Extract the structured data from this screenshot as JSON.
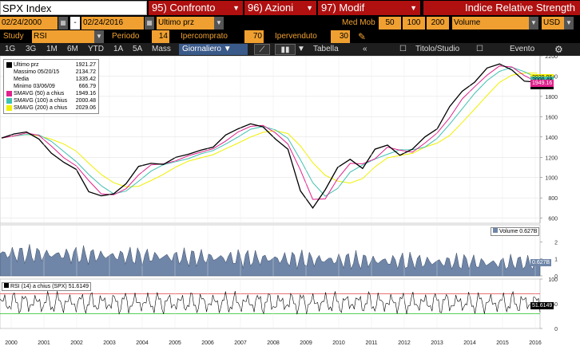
{
  "header": {
    "ticker": "SPX Index",
    "confronto": "95) Confronto",
    "azioni": "96) Azioni",
    "modif": "97) Modif",
    "title": "Indice Relative Strength"
  },
  "controls": {
    "date_from": "02/24/2000",
    "date_sep": "-",
    "date_to": "02/24/2016",
    "price_field": "Ultimo prz",
    "med_mob_label": "Med Mob",
    "ma1": "50",
    "ma2": "100",
    "ma3": "200",
    "volume_field": "Volume",
    "currency": "USD"
  },
  "study_row": {
    "study_label": "Study",
    "study_value": "RSI",
    "periodo_label": "Periodo",
    "periodo_value": "14",
    "ipercomprato_label": "Ipercomprato",
    "ipercomprato_value": "70",
    "ipervenduto_label": "Ipervenduto",
    "ipervenduto_value": "30"
  },
  "toolbar": {
    "ranges": [
      "1G",
      "3G",
      "1M",
      "6M",
      "YTD",
      "1A",
      "5A",
      "Mass"
    ],
    "period": "Giornaliero",
    "tabella": "Tabella",
    "titolo": "Titolo/Studio",
    "evento": "Evento"
  },
  "legend": {
    "items": [
      {
        "label": "Ultimo prz",
        "value": "1921.27",
        "color": "#000000"
      },
      {
        "label": "Massimo 05/20/15",
        "value": "2134.72",
        "color": ""
      },
      {
        "label": "Media",
        "value": "1335.42",
        "color": ""
      },
      {
        "label": "Minimo 03/06/09",
        "value": "666.79",
        "color": ""
      },
      {
        "label": "SMAVG (50) a chius",
        "value": "1949.16",
        "color": "#e0208c"
      },
      {
        "label": "SMAVG (100) a chius",
        "value": "2000.48",
        "color": "#40c0b0"
      },
      {
        "label": "SMAVG (200) a chius",
        "value": "2029.06",
        "color": "#f0f000"
      }
    ]
  },
  "volume_legend": "Volume 0.627B",
  "rsi_legend": "RSI (14) a chius (SPX) 51.6149",
  "price_tags": {
    "last": "1921.27",
    "ma_a": "2029.06",
    "ma_b": "2000.48",
    "ma_c": "1949.16"
  },
  "volume_tag": "0.627B",
  "rsi_tag": "51.6149",
  "colors": {
    "red_menu": "#b01010",
    "orange_field": "#f0a030",
    "price_line": "#000000",
    "ma50": "#e0208c",
    "ma100": "#40c0b0",
    "ma200": "#f0f000",
    "volume_fill": "#6f86a8",
    "rsi_over": "#e04040",
    "rsi_under": "#20c020"
  },
  "chart_data": [
    {
      "type": "line",
      "title": "SPX Index",
      "ylim": [
        550,
        2200
      ],
      "y_ticks": [
        600,
        800,
        1000,
        1200,
        1400,
        1600,
        1800,
        2000,
        2200
      ],
      "x": [
        "2000",
        "2001",
        "2002",
        "2003",
        "2004",
        "2005",
        "2006",
        "2007",
        "2008",
        "2009",
        "2010",
        "2011",
        "2012",
        "2013",
        "2014",
        "2015",
        "2016"
      ],
      "series": [
        {
          "name": "Ultimo prz",
          "values": [
            1390,
            1430,
            1450,
            1380,
            1240,
            1150,
            1080,
            860,
            820,
            840,
            940,
            1110,
            1140,
            1130,
            1200,
            1230,
            1270,
            1300,
            1420,
            1480,
            1530,
            1500,
            1380,
            1280,
            870,
            700,
            880,
            1100,
            1180,
            1090,
            1280,
            1320,
            1220,
            1280,
            1400,
            1480,
            1700,
            1850,
            1940,
            2080,
            2120,
            2060,
            1950,
            1940
          ]
        }
      ],
      "x_tick_labels": [
        "2000",
        "2001",
        "2002",
        "2003",
        "2004",
        "2005",
        "2006",
        "2007",
        "2008",
        "2009",
        "2010",
        "2011",
        "2012",
        "2013",
        "2014",
        "2015",
        "2016"
      ]
    },
    {
      "type": "area",
      "title": "Volume",
      "ylim": [
        0,
        3
      ],
      "y_ticks": [
        0,
        1,
        2
      ],
      "ylabel": ""
    },
    {
      "type": "line",
      "title": "RSI (14)",
      "ylim": [
        0,
        100
      ],
      "y_ticks": [
        0,
        50,
        100
      ],
      "overbought": 70,
      "oversold": 30
    }
  ]
}
